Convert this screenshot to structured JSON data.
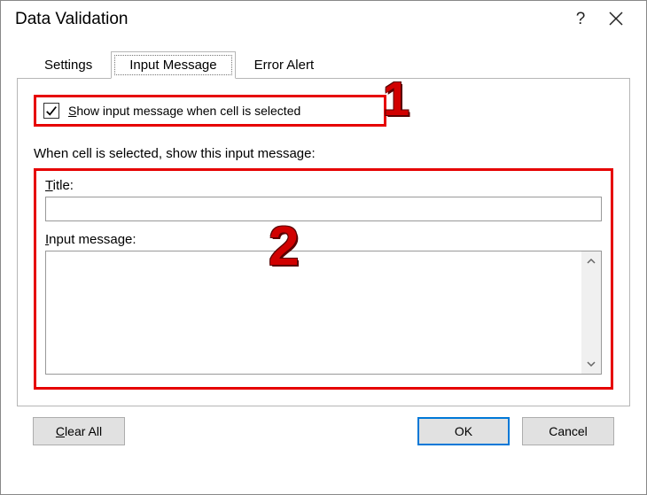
{
  "dialog": {
    "title": "Data Validation"
  },
  "tabs": {
    "settings": "Settings",
    "input_message": "Input Message",
    "error_alert": "Error Alert"
  },
  "checkbox": {
    "prefix_u": "S",
    "rest": "how input message when cell is selected",
    "checked": true
  },
  "section_label": "When cell is selected, show this input message:",
  "title_field": {
    "prefix_u": "T",
    "rest": "itle:",
    "value": ""
  },
  "message_field": {
    "prefix_u": "I",
    "rest": "nput message:",
    "value": ""
  },
  "buttons": {
    "clear_prefix_u": "C",
    "clear_rest": "lear All",
    "ok": "OK",
    "cancel": "Cancel"
  },
  "annotations": {
    "one": "1",
    "two": "2"
  }
}
